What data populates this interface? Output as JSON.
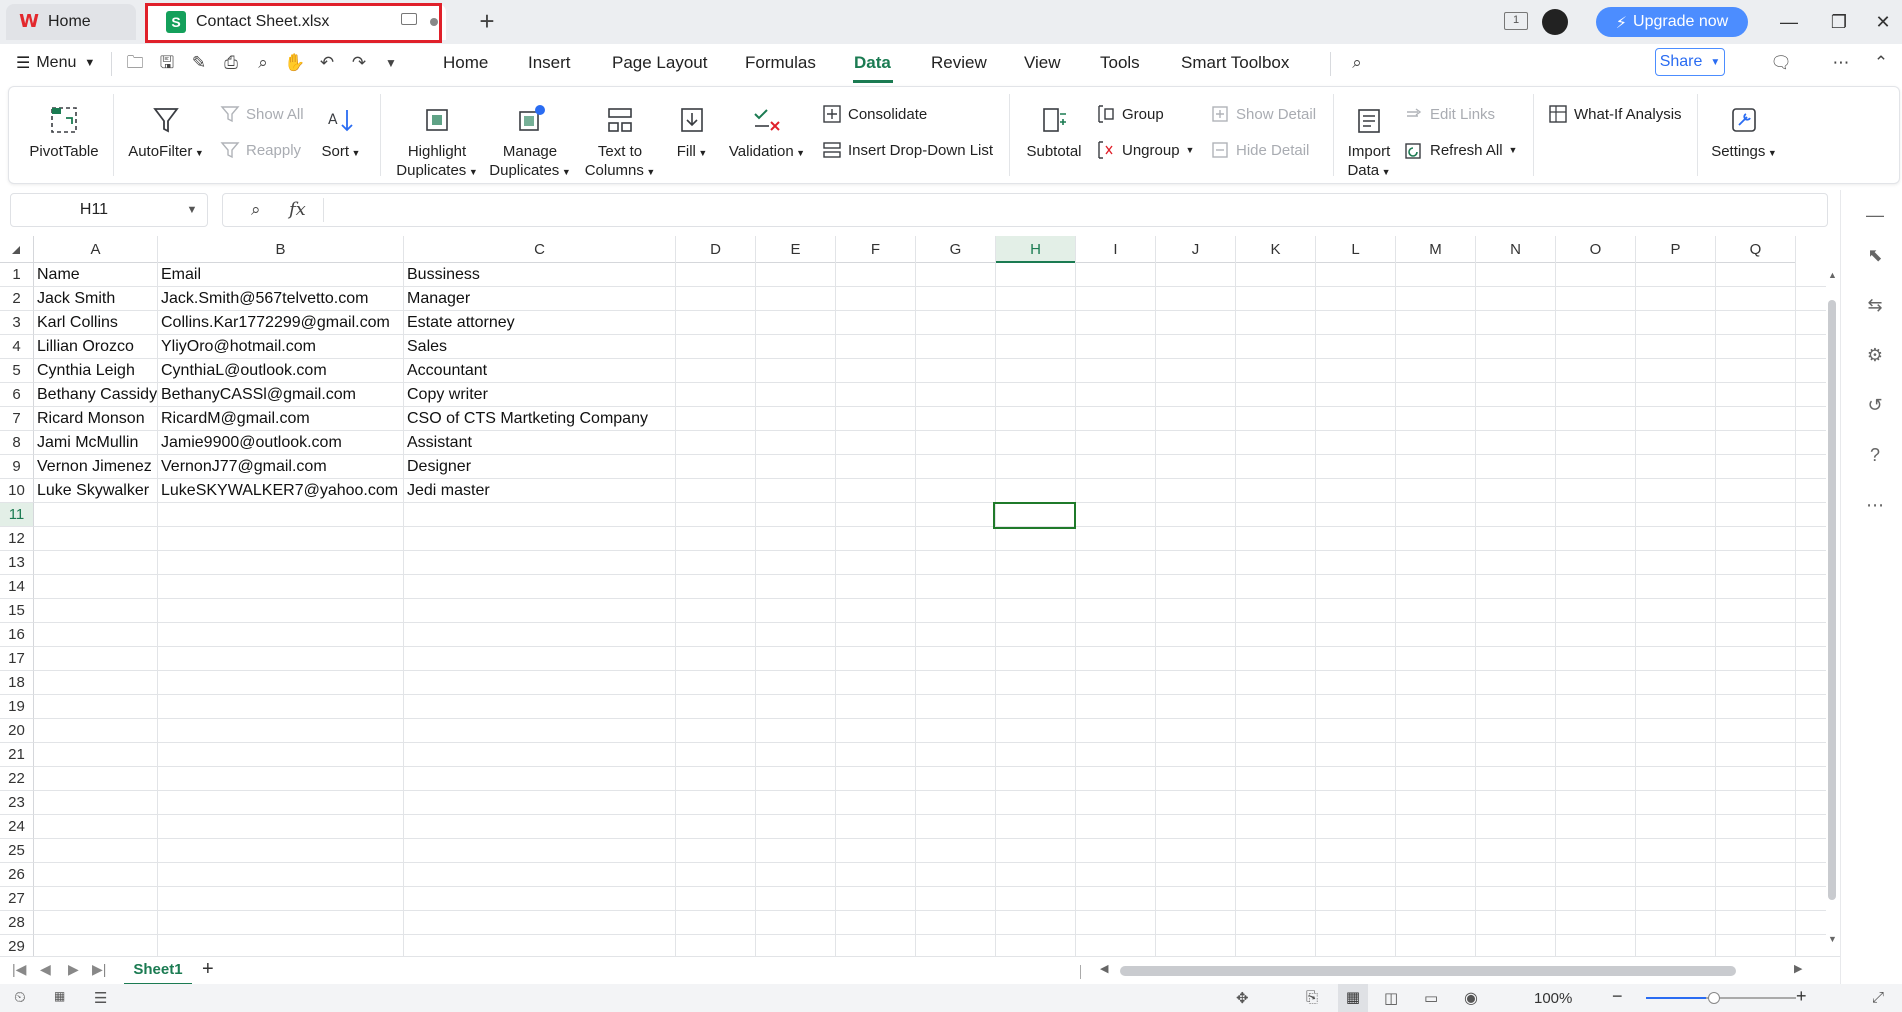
{
  "titlebar": {
    "home_tab": "Home",
    "file_tab": "Contact Sheet.xlsx",
    "upgrade": "Upgrade now",
    "page_count": "1"
  },
  "menu": {
    "menu_label": "Menu",
    "tabs": [
      "Home",
      "Insert",
      "Page Layout",
      "Formulas",
      "Data",
      "Review",
      "View",
      "Tools",
      "Smart Toolbox"
    ],
    "active_tab": "Data",
    "share": "Share"
  },
  "ribbon": {
    "pivottable": "PivotTable",
    "autofilter": "AutoFilter",
    "show_all": "Show All",
    "reapply": "Reapply",
    "sort": "Sort",
    "highlight_duplicates": [
      "Highlight",
      "Duplicates"
    ],
    "manage_duplicates": [
      "Manage",
      "Duplicates"
    ],
    "text_to_columns": [
      "Text to",
      "Columns"
    ],
    "fill": "Fill",
    "validation": "Validation",
    "consolidate": "Consolidate",
    "insert_dropdown": "Insert Drop-Down List",
    "subtotal": "Subtotal",
    "group": "Group",
    "ungroup": "Ungroup",
    "show_detail": "Show Detail",
    "hide_detail": "Hide Detail",
    "import_data": [
      "Import",
      "Data"
    ],
    "edit_links": "Edit Links",
    "refresh_all": "Refresh All",
    "what_if": "What-If Analysis",
    "settings": "Settings"
  },
  "formula_bar": {
    "cell_ref": "H11",
    "formula": ""
  },
  "sheet": {
    "columns": [
      "A",
      "B",
      "C",
      "D",
      "E",
      "F",
      "G",
      "H",
      "I",
      "J",
      "K",
      "L",
      "M",
      "N",
      "O",
      "P",
      "Q"
    ],
    "selected_column": "H",
    "selected_row": "11",
    "rows": [
      [
        "Name",
        "Email",
        "Bussiness"
      ],
      [
        "Jack Smith",
        "Jack.Smith@567telvetto.com",
        "Manager"
      ],
      [
        "Karl Collins",
        "Collins.Kar1772299@gmail.com",
        "Estate attorney"
      ],
      [
        "Lillian Orozco",
        "YliyOro@hotmail.com",
        "Sales"
      ],
      [
        "Cynthia Leigh",
        "CynthiaL@outlook.com",
        "Accountant"
      ],
      [
        "Bethany Cassidy",
        "BethanyCASSl@gmail.com",
        "Copy writer"
      ],
      [
        "Ricard Monson",
        "RicardM@gmail.com",
        "CSO of CTS Martketing Company"
      ],
      [
        "Jami McMullin",
        "Jamie9900@outlook.com",
        "Assistant"
      ],
      [
        "Vernon Jimenez",
        "VernonJ77@gmail.com",
        "Designer"
      ],
      [
        "Luke Skywalker",
        "LukeSKYWALKER7@yahoo.com",
        "Jedi master"
      ]
    ],
    "row_numbers": [
      "1",
      "2",
      "3",
      "4",
      "5",
      "6",
      "7",
      "8",
      "9",
      "10",
      "11",
      "12",
      "13",
      "14",
      "15",
      "16",
      "17",
      "18",
      "19",
      "20",
      "21",
      "22",
      "23",
      "24",
      "25",
      "26",
      "27",
      "28",
      "29"
    ]
  },
  "sheetbar": {
    "sheet_name": "Sheet1"
  },
  "status": {
    "zoom": "100%"
  },
  "colors": {
    "accent": "#1b7b52",
    "tab_outline": "#e0202a",
    "upgrade": "#4c8dff"
  }
}
